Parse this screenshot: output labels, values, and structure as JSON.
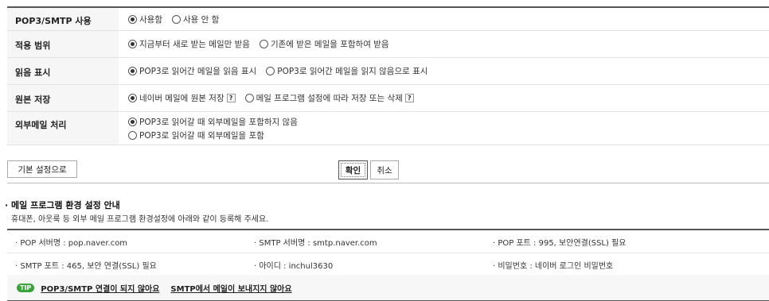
{
  "settings": {
    "rows": [
      {
        "label": "POP3/SMTP 사용",
        "options": [
          {
            "text": "사용함",
            "selected": true
          },
          {
            "text": "사용 안 함",
            "selected": false
          }
        ]
      },
      {
        "label": "적용 범위",
        "options": [
          {
            "text": "지금부터 새로 받는 메일만 받음",
            "selected": true
          },
          {
            "text": "기존에 받은 메일을 포함하여 받음",
            "selected": false
          }
        ]
      },
      {
        "label": "읽음 표시",
        "options": [
          {
            "text": "POP3로 읽어간 메일을 읽음 표시",
            "selected": true
          },
          {
            "text": "POP3로 읽어간 메일을 읽지 않음으로 표시",
            "selected": false
          }
        ]
      },
      {
        "label": "원본 저장",
        "options": [
          {
            "text": "네이버 메일에 원본 저장",
            "selected": true,
            "help": "?"
          },
          {
            "text": "메일 프로그램 설정에 따라 저장 또는 삭제",
            "selected": false,
            "help": "?"
          }
        ]
      },
      {
        "label": "외부메일 처리",
        "options": [
          {
            "text": "POP3로 읽어갈 때 외부메일을 포함하지 않음",
            "selected": true
          },
          {
            "text": "POP3로 읽어갈 때 외부메일을 포함",
            "selected": false
          }
        ]
      }
    ]
  },
  "buttons": {
    "default_label": "기본 설정으로",
    "confirm_label": "확인",
    "cancel_label": "취소"
  },
  "guide": {
    "title": "· 메일 프로그램 환경 설정 안내",
    "desc": "휴대폰, 아웃룩 등 외부 메일 프로그램 환경설정에 아래와 같이 등록해 주세요.",
    "items": [
      [
        "· POP 서버명 : pop.naver.com",
        "· SMTP 서버명 : smtp.naver.com",
        "· POP 포트 : 995, 보안연결(SSL) 필요"
      ],
      [
        "· SMTP 포트 : 465, 보안 연결(SSL) 필요",
        "· 아이디 : inchul3630",
        "· 비밀번호 : 네이버 로그인 비밀번호"
      ]
    ]
  },
  "tip": {
    "badge": "TIP",
    "links": [
      "POP3/SMTP 연결이 되지 않아요",
      "SMTP에서 메일이 보내지지 않아요"
    ]
  }
}
